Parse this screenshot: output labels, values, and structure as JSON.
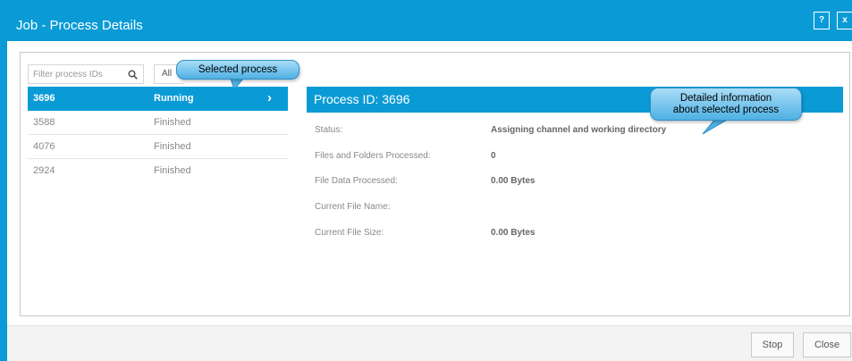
{
  "window": {
    "title": "Job - Process Details",
    "help_label": "?",
    "close_label": "x"
  },
  "filter": {
    "placeholder": "Filter process IDs",
    "status_selected": "All"
  },
  "processes": [
    {
      "id": "3696",
      "status": "Running",
      "selected": true
    },
    {
      "id": "3588",
      "status": "Finished",
      "selected": false
    },
    {
      "id": "4076",
      "status": "Finished",
      "selected": false
    },
    {
      "id": "2924",
      "status": "Finished",
      "selected": false
    }
  ],
  "details": {
    "header": "Process ID: 3696",
    "fields": [
      {
        "label": "Status:",
        "value": "Assigning channel and working directory"
      },
      {
        "label": "Files and Folders Processed:",
        "value": "0"
      },
      {
        "label": "File Data Processed:",
        "value": "0.00 Bytes"
      },
      {
        "label": "Current File Name:",
        "value": ""
      },
      {
        "label": "Current File Size:",
        "value": "0.00 Bytes"
      }
    ]
  },
  "footer": {
    "stop_label": "Stop",
    "close_label": "Close"
  },
  "callouts": {
    "selected_process": "Selected process",
    "detailed_line1": "Detailed information",
    "detailed_line2": "about selected process"
  },
  "colors": {
    "accent": "#0a9bd6"
  }
}
